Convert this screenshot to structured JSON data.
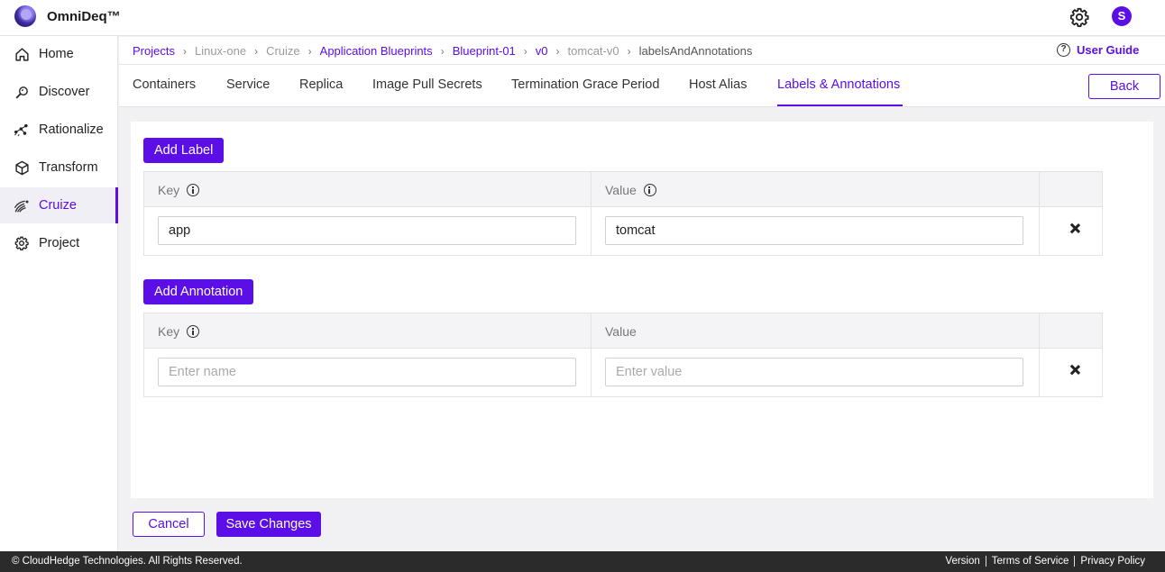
{
  "app": {
    "brand": "OmniDeq™",
    "avatar_initial": "S",
    "accent": "#5b0ee6"
  },
  "sidebar": {
    "items": [
      {
        "label": "Home",
        "icon": "home-icon"
      },
      {
        "label": "Discover",
        "icon": "discover-icon"
      },
      {
        "label": "Rationalize",
        "icon": "rationalize-icon"
      },
      {
        "label": "Transform",
        "icon": "cube-icon"
      },
      {
        "label": "Cruize",
        "icon": "cruize-icon",
        "active": true
      },
      {
        "label": "Project",
        "icon": "gear-icon"
      }
    ]
  },
  "breadcrumb": [
    "Projects",
    "Linux-one",
    "Cruize",
    "Application Blueprints",
    "Blueprint-01",
    "v0",
    "tomcat-v0",
    "labelsAndAnnotations"
  ],
  "user_guide": "User Guide",
  "tabs": [
    "Containers",
    "Service",
    "Replica",
    "Image Pull Secrets",
    "Termination Grace Period",
    "Host Alias",
    "Labels & Annotations"
  ],
  "active_tab": "Labels & Annotations",
  "back_label": "Back",
  "labels": {
    "add_button": "Add Label",
    "key_header": "Key",
    "value_header": "Value",
    "rows": [
      {
        "key": "app",
        "value": "tomcat"
      }
    ]
  },
  "annotations": {
    "add_button": "Add Annotation",
    "key_header": "Key",
    "value_header": "Value",
    "key_placeholder": "Enter name",
    "value_placeholder": "Enter value"
  },
  "actions": {
    "cancel": "Cancel",
    "save": "Save Changes"
  },
  "footer": {
    "copyright": "© CloudHedge Technologies. All Rights Reserved.",
    "links": [
      "Version",
      "Terms of Service",
      "Privacy Policy"
    ]
  }
}
